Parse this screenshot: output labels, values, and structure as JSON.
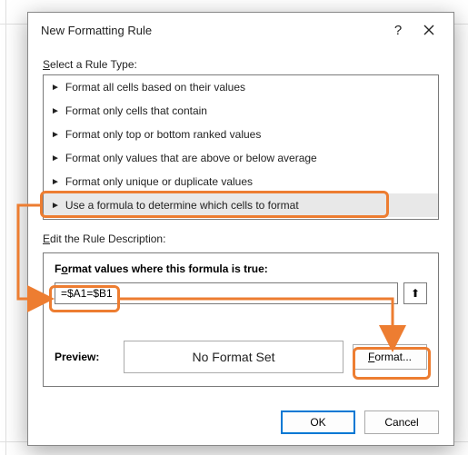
{
  "dialog": {
    "title": "New Formatting Rule",
    "help_char": "?",
    "select_label_pre": "S",
    "select_label_rest": "elect a Rule Type:",
    "edit_label_pre": "E",
    "edit_label_rest": "dit the Rule Description:",
    "subhead_pre": "F",
    "subhead_mid": "o",
    "subhead_rest": "rmat values where this formula is true:",
    "formula_value": "=$A1=$B1",
    "ref_btn_glyph": "⬆",
    "preview_label": "Preview:",
    "preview_text": "No Format Set",
    "format_btn_pre": "F",
    "format_btn_rest": "ormat...",
    "ok_label": "OK",
    "cancel_label": "Cancel"
  },
  "rule_types": {
    "items": [
      {
        "label": "Format all cells based on their values"
      },
      {
        "label": "Format only cells that contain"
      },
      {
        "label": "Format only top or bottom ranked values"
      },
      {
        "label": "Format only values that are above or below average"
      },
      {
        "label": "Format only unique or duplicate values"
      },
      {
        "label": "Use a formula to determine which cells to format"
      }
    ]
  },
  "annotations": {
    "color": "#ed7d31"
  }
}
